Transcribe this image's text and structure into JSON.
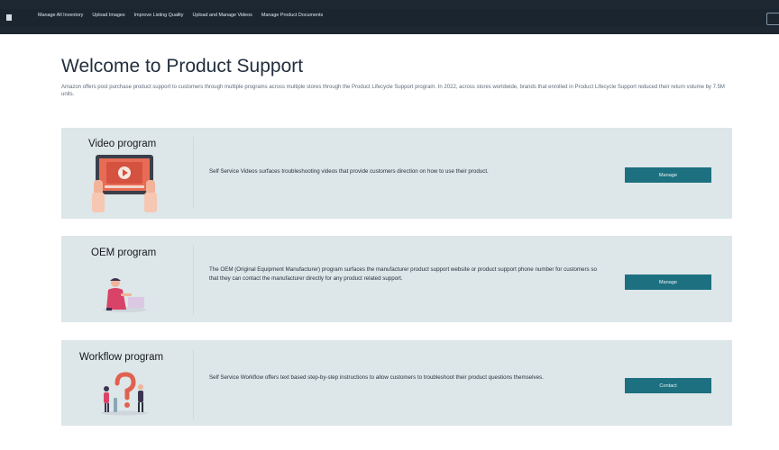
{
  "nav": {
    "items": [
      "Manage All Inventory",
      "Upload Images",
      "Improve Listing Quality",
      "Upload and Manage Videos",
      "Manage Product Documents"
    ]
  },
  "page": {
    "title": "Welcome to Product Support",
    "intro": "Amazon offers post purchase product support to customers through multiple programs across multiple stores through the Product Lifecycle Support program. In 2022, across stores worldwide, brands that enrolled in Product Lifecycle Support reduced their return volume by 7.5M units."
  },
  "programs": [
    {
      "title": "Video program",
      "description": "Self Service Videos surfaces troubleshooting videos that provide customers direction on how to use their product.",
      "button": "Manage",
      "icon": "video-tablet-icon"
    },
    {
      "title": "OEM program",
      "description": "The OEM (Original Equipment Manufacturer) program surfaces the manufacturer product support website or product support phone number for customers so that they can contact the manufacturer directly for any product related support.",
      "button": "Manage",
      "icon": "support-person-icon"
    },
    {
      "title": "Workflow program",
      "description": "Self Service Workflow offers text based step-by-step instructions to allow customers to troubleshoot their product questions themselves.",
      "button": "Contact",
      "icon": "question-people-icon"
    }
  ],
  "colors": {
    "topbar": "#1d2833",
    "card": "#dde6e8",
    "button": "#1c7080",
    "illustration_accent": "#e0614f"
  }
}
